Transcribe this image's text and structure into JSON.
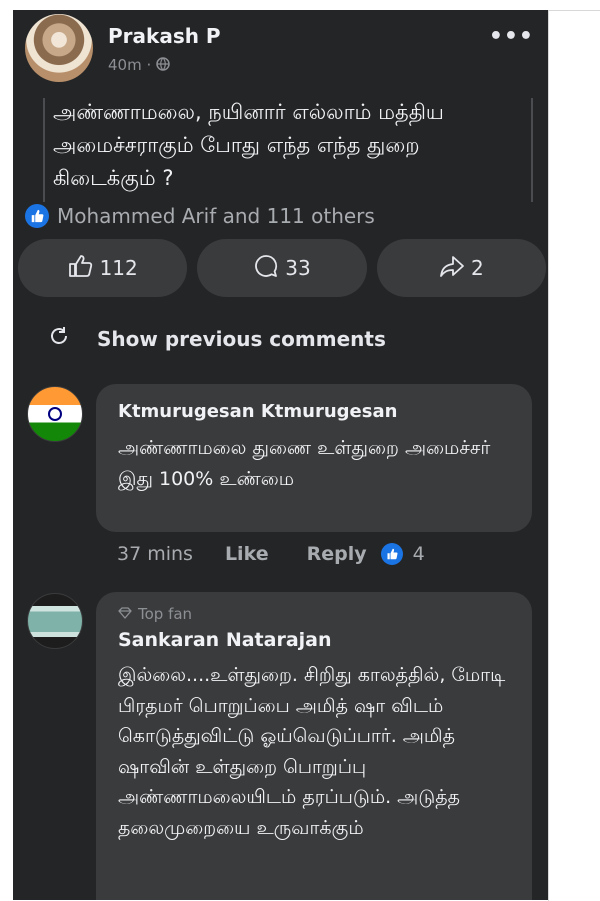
{
  "post": {
    "author": "Prakash P",
    "time": "40m",
    "privacy_icon": "globe-icon",
    "text": "அண்ணாமலை, நயினார் எல்லாம் மத்திய அமைச்சராகும் போது எந்த எந்த துறை கிடைக்கும் ?",
    "reactions_summary": "Mohammed Arif and 111 others"
  },
  "actions": {
    "like_count": "112",
    "comment_count": "33",
    "share_count": "2"
  },
  "show_previous": "Show previous comments",
  "comments": [
    {
      "name": "Ktmurugesan Ktmurugesan",
      "text": "அண்ணாமலை துணை உள்துறை அமைச்சர் இது 100% உண்மை",
      "time": "37 mins",
      "like_label": "Like",
      "reply_label": "Reply",
      "reaction_count": "4"
    },
    {
      "badge": "Top fan",
      "name": "Sankaran Natarajan",
      "text": "இல்லை....உள்துறை. சிறிது காலத்தில், மோடி பிரதமர் பொறுப்பை அமித் ஷா விடம் கொடுத்துவிட்டு ஓய்வெடுப்பார். அமித் ஷாவின் உள்துறை பொறுப்பு அண்ணாமலையிடம் தரப்படும். அடுத்த தலைமுறையை உருவாக்கும்"
    }
  ],
  "colors": {
    "background": "#242526",
    "bubble": "#3a3b3c",
    "accent": "#1b74e4"
  }
}
